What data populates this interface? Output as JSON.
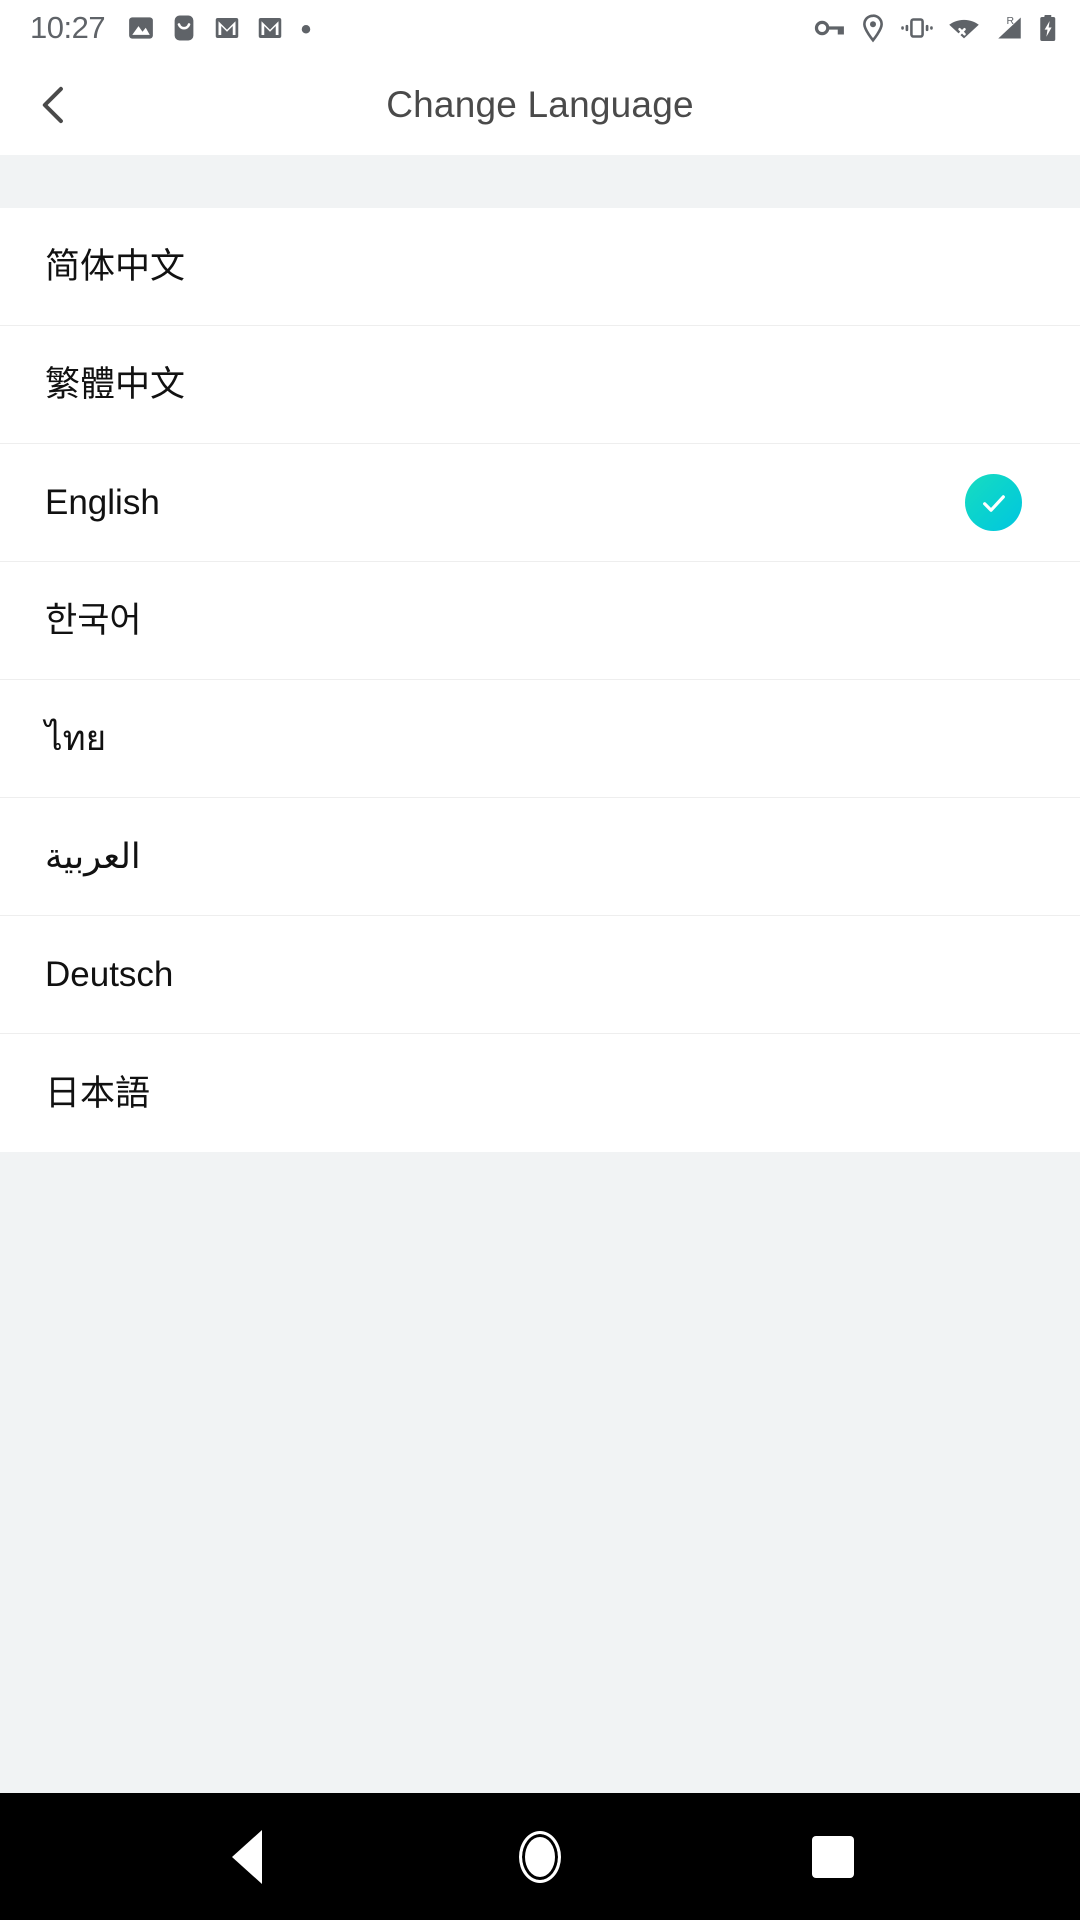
{
  "status_bar": {
    "time": "10:27",
    "left_icons": [
      "image-icon",
      "messenger-icon",
      "gmail-icon",
      "gmail-icon",
      "dot-icon"
    ],
    "right_icons": [
      "vpn-key-icon",
      "location-pin-icon",
      "vibrate-icon",
      "wifi-off-icon",
      "roaming-signal-icon",
      "battery-charging-icon"
    ],
    "roaming_label": "R",
    "icon_color": "#5f6368"
  },
  "header": {
    "back_icon": "chevron-left-icon",
    "title": "Change Language",
    "title_color": "#4a4a4a",
    "background": "#ffffff"
  },
  "theme": {
    "page_background": "#f1f3f4",
    "row_background": "#ffffff",
    "divider": "#eeeeee",
    "accent_start": "#18dcc0",
    "accent_end": "#00c6e0",
    "label_color": "#111111",
    "navbar_background": "#000000"
  },
  "language_list": {
    "selected_index": 2,
    "check_icon": "check-icon",
    "items": [
      {
        "label": "简体中文",
        "selected": false,
        "rtl": false
      },
      {
        "label": "繁體中文",
        "selected": false,
        "rtl": false
      },
      {
        "label": "English",
        "selected": true,
        "rtl": false
      },
      {
        "label": "한국어",
        "selected": false,
        "rtl": false
      },
      {
        "label": "ไทย",
        "selected": false,
        "rtl": false
      },
      {
        "label": "العربية",
        "selected": false,
        "rtl": true
      },
      {
        "label": "Deutsch",
        "selected": false,
        "rtl": false
      },
      {
        "label": "日本語",
        "selected": false,
        "rtl": false
      }
    ]
  },
  "navigation_bar": {
    "buttons": [
      {
        "name": "nav-back-button",
        "icon": "triangle-back-icon"
      },
      {
        "name": "nav-home-button",
        "icon": "circle-home-icon"
      },
      {
        "name": "nav-recents-button",
        "icon": "square-recents-icon"
      }
    ]
  }
}
